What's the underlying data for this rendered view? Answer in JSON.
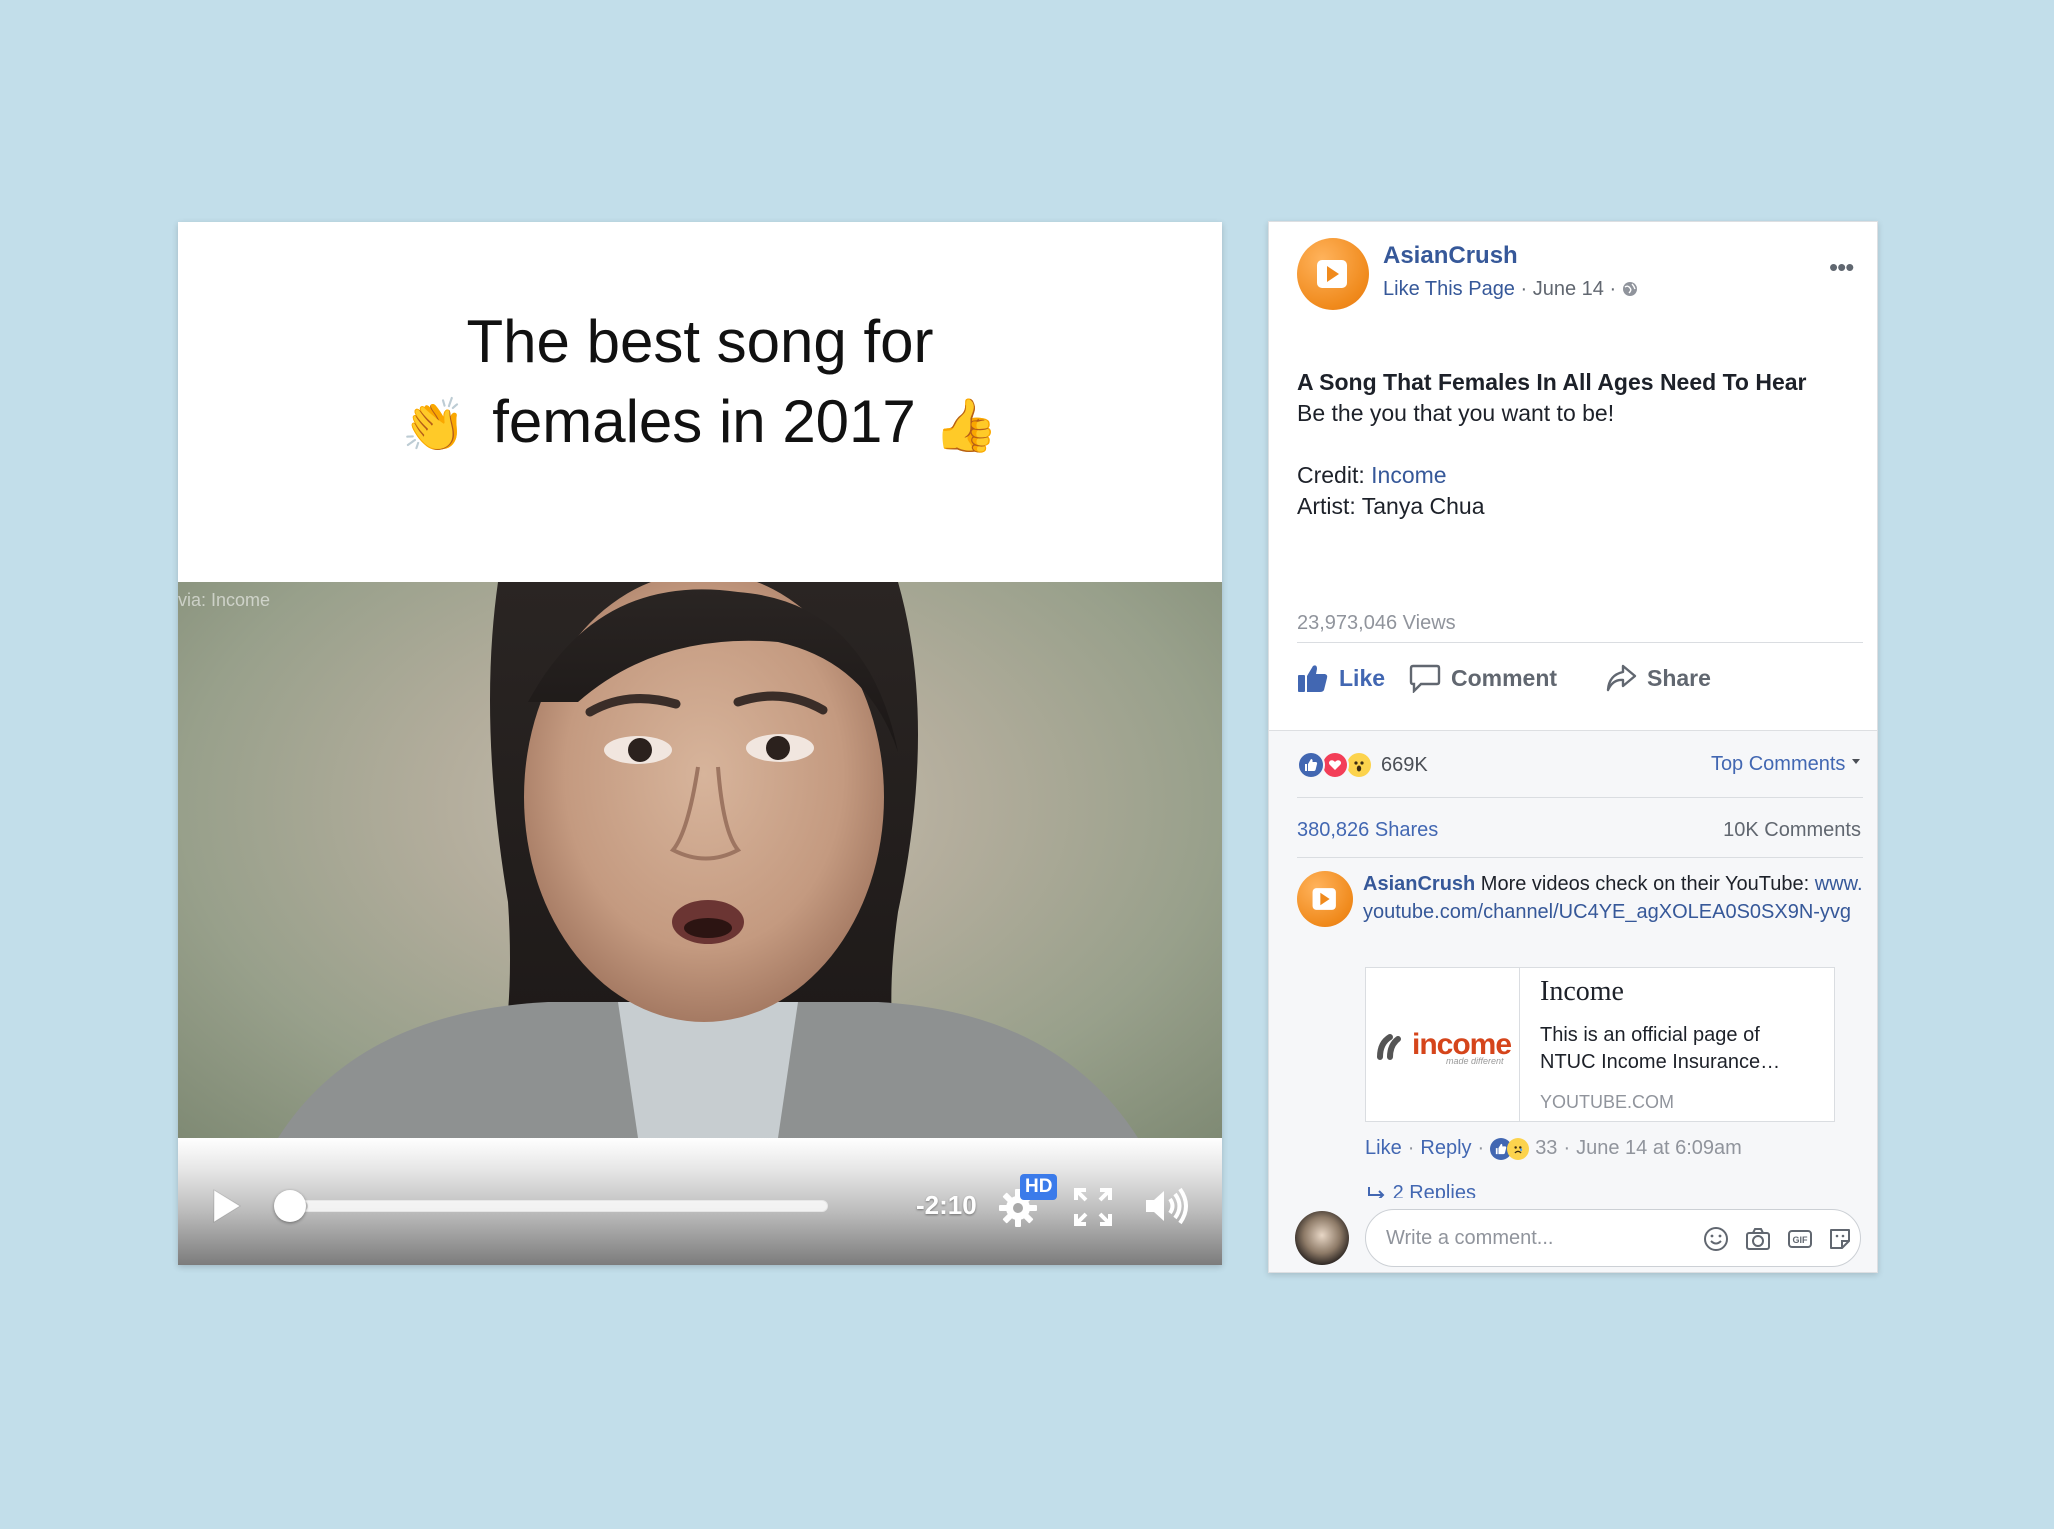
{
  "video": {
    "title_line1": "The best song for",
    "title_line2": "females in 2017",
    "clap_emoji": "👏",
    "thumbs_emoji": "👍",
    "watermark": "via: Income",
    "time_remaining": "-2:10",
    "quality_badge": "HD",
    "progress_fraction": 0.06,
    "icons": {
      "play": "play-icon",
      "settings": "gear-icon",
      "fullscreen": "fullscreen-icon",
      "volume": "volume-icon"
    }
  },
  "post": {
    "page_name": "AsianCrush",
    "like_page": "Like This Page",
    "meta_sep": " · ",
    "date": "June 14",
    "more": "•••",
    "headline": "A Song That Females In All Ages Need To Hear",
    "tagline": "Be the you that you want to be!",
    "credit_label": "Credit: ",
    "credit_value": "Income",
    "artist_line": "Artist: Tanya Chua",
    "views": "23,973,046 Views",
    "actions": {
      "like": "Like",
      "comment": "Comment",
      "share": "Share"
    },
    "reaction_count": "669K",
    "top_comments": "Top Comments",
    "shares": "380,826 Shares",
    "comments": "10K Comments",
    "brand_color": "#f08a1c",
    "link_color": "#365899"
  },
  "comment": {
    "author": "AsianCrush",
    "text": " More videos check on their YouTube: ",
    "link": "www.youtube.com/channel/UC4YE_agXOLEA0S0SX9N-yvg",
    "preview": {
      "logo_text": "income",
      "logo_sub": "made different",
      "title": "Income",
      "description": "This is an official page of NTUC Income Insurance…",
      "domain": "YOUTUBE.COM"
    },
    "like": "Like",
    "reply": "Reply",
    "dot": "·",
    "reaction_count": "33",
    "timestamp": "June 14 at 6:09am",
    "replies": "2 Replies"
  },
  "composer": {
    "placeholder": "Write a comment..."
  }
}
